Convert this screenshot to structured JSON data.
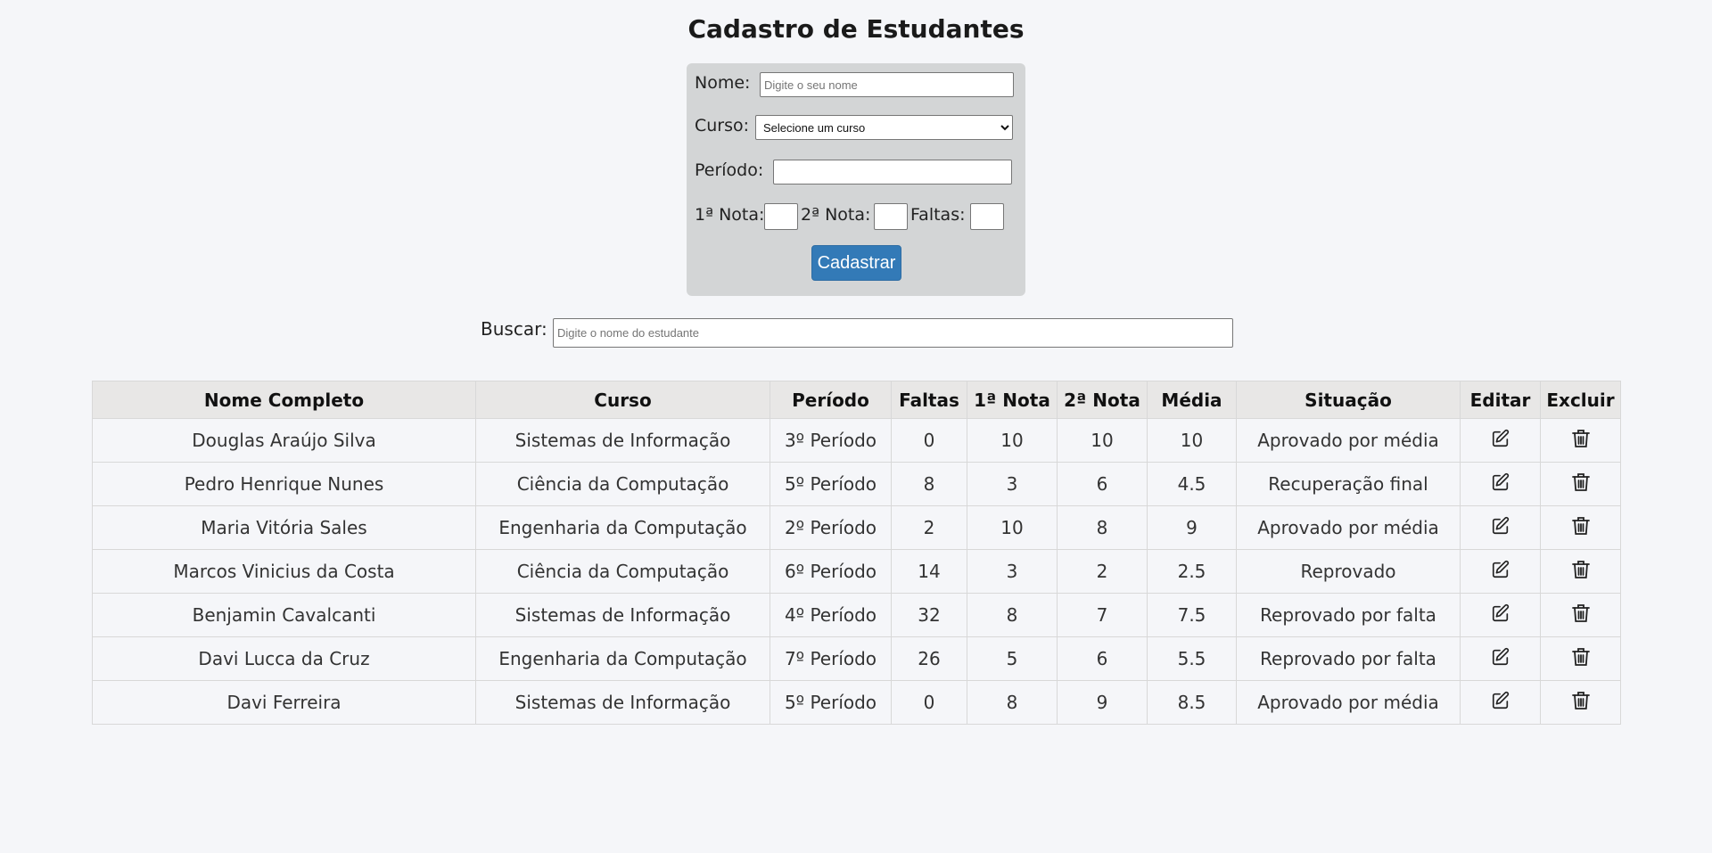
{
  "page": {
    "title": "Cadastro de Estudantes"
  },
  "form": {
    "nome_label": "Nome:",
    "nome_placeholder": "Digite o seu nome",
    "curso_label": "Curso:",
    "curso_selected": "Selecione um curso",
    "periodo_label": "Período:",
    "nota1_label": "1ª Nota:",
    "nota2_label": "2ª Nota:",
    "faltas_label": "Faltas:",
    "submit_label": "Cadastrar"
  },
  "search": {
    "label": "Buscar:",
    "placeholder": "Digite o nome do estudante"
  },
  "table": {
    "headers": [
      "Nome Completo",
      "Curso",
      "Período",
      "Faltas",
      "1ª Nota",
      "2ª Nota",
      "Média",
      "Situação",
      "Editar",
      "Excluir"
    ],
    "rows": [
      {
        "nome": "Douglas Araújo Silva",
        "curso": "Sistemas de Informação",
        "periodo": "3º Período",
        "faltas": "0",
        "nota1": "10",
        "nota2": "10",
        "media": "10",
        "situacao": "Aprovado por média"
      },
      {
        "nome": "Pedro Henrique Nunes",
        "curso": "Ciência da Computação",
        "periodo": "5º Período",
        "faltas": "8",
        "nota1": "3",
        "nota2": "6",
        "media": "4.5",
        "situacao": "Recuperação final"
      },
      {
        "nome": "Maria Vitória Sales",
        "curso": "Engenharia da Computação",
        "periodo": "2º Período",
        "faltas": "2",
        "nota1": "10",
        "nota2": "8",
        "media": "9",
        "situacao": "Aprovado por média"
      },
      {
        "nome": "Marcos Vinicius da Costa",
        "curso": "Ciência da Computação",
        "periodo": "6º Período",
        "faltas": "14",
        "nota1": "3",
        "nota2": "2",
        "media": "2.5",
        "situacao": "Reprovado"
      },
      {
        "nome": "Benjamin Cavalcanti",
        "curso": "Sistemas de Informação",
        "periodo": "4º Período",
        "faltas": "32",
        "nota1": "8",
        "nota2": "7",
        "media": "7.5",
        "situacao": "Reprovado por falta"
      },
      {
        "nome": "Davi Lucca da Cruz",
        "curso": "Engenharia da Computação",
        "periodo": "7º Período",
        "faltas": "26",
        "nota1": "5",
        "nota2": "6",
        "media": "5.5",
        "situacao": "Reprovado por falta"
      },
      {
        "nome": "Davi Ferreira",
        "curso": "Sistemas de Informação",
        "periodo": "5º Período",
        "faltas": "0",
        "nota1": "8",
        "nota2": "9",
        "media": "8.5",
        "situacao": "Aprovado por média"
      }
    ],
    "icons": {
      "edit": "edit-icon",
      "delete": "trash-icon"
    }
  },
  "colors": {
    "background": "#f5f6f9",
    "form_card": "#d3d5d6",
    "primary_button": "#337ab7",
    "table_header": "#e8e7e6"
  }
}
